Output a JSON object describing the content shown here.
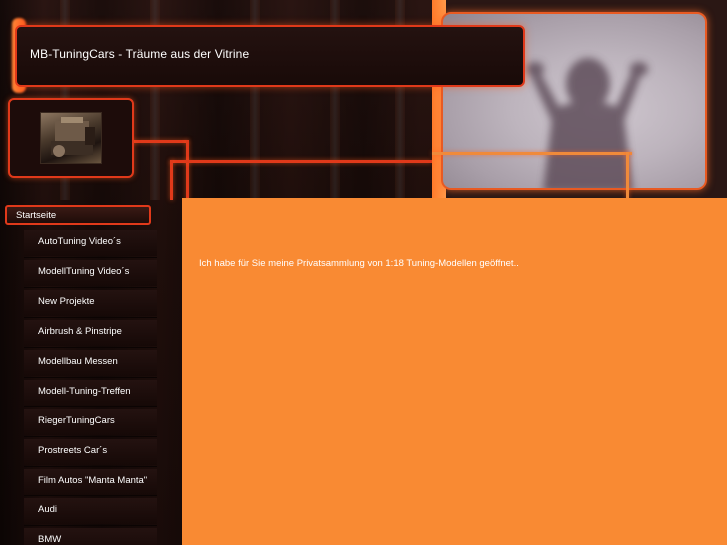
{
  "header": {
    "title": "MB-TuningCars - Träume aus der Vitrine"
  },
  "nav": {
    "active": "Startseite",
    "items": [
      {
        "label": "AutoTuning Video´s"
      },
      {
        "label": "ModellTuning Video´s"
      },
      {
        "label": "New Projekte"
      },
      {
        "label": "Airbrush & Pinstripe"
      },
      {
        "label": "Modellbau Messen"
      },
      {
        "label": "Modell-Tuning-Treffen"
      },
      {
        "label": "RiegerTuningCars"
      },
      {
        "label": "Prostreets Car´s"
      },
      {
        "label": "Film Autos \"Manta Manta\""
      },
      {
        "label": "Audi"
      },
      {
        "label": "BMW"
      }
    ]
  },
  "content": {
    "intro": "Ich habe für Sie meine Privatsammlung von 1:18 Tuning-Modellen geöffnet.."
  },
  "colors": {
    "accent": "#e0391a",
    "content_bg": "#f98a33",
    "dark_bg": "#1a0d0a"
  }
}
